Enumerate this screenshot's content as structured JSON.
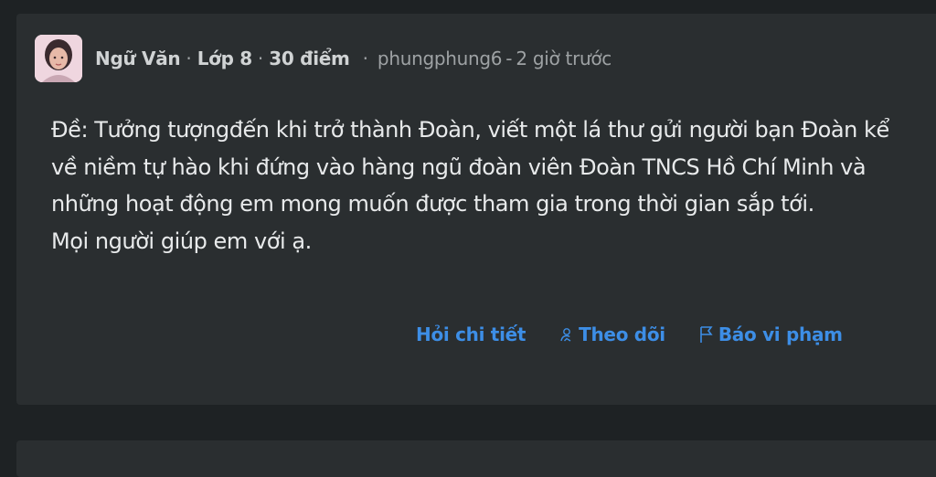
{
  "question": {
    "subject": "Ngữ Văn",
    "grade": "Lớp 8",
    "points": "30 điểm",
    "author": "phungphung6",
    "time": "2 giờ trước",
    "content_lines": [
      "Đề: Tưởng tượngđến khi trở thành Đoàn, viết một lá thư gửi người bạn Đoàn kể về niềm tự hào khi đứng vào hàng ngũ đoàn viên Đoàn TNCS Hồ Chí Minh và những hoạt động em mong muốn được tham gia trong thời gian sắp tới.",
      "Mọi người giúp em với ạ."
    ]
  },
  "actions": {
    "ask_detail": "Hỏi chi tiết",
    "follow": "Theo dõi",
    "report": "Báo vi phạm"
  },
  "icons": {
    "follow": "user-follow-icon",
    "report": "flag-icon"
  },
  "colors": {
    "background": "#1e2224",
    "card": "#2a2e30",
    "text": "#e8eaeb",
    "muted": "#9ea2a4",
    "accent": "#3d8ee6"
  }
}
